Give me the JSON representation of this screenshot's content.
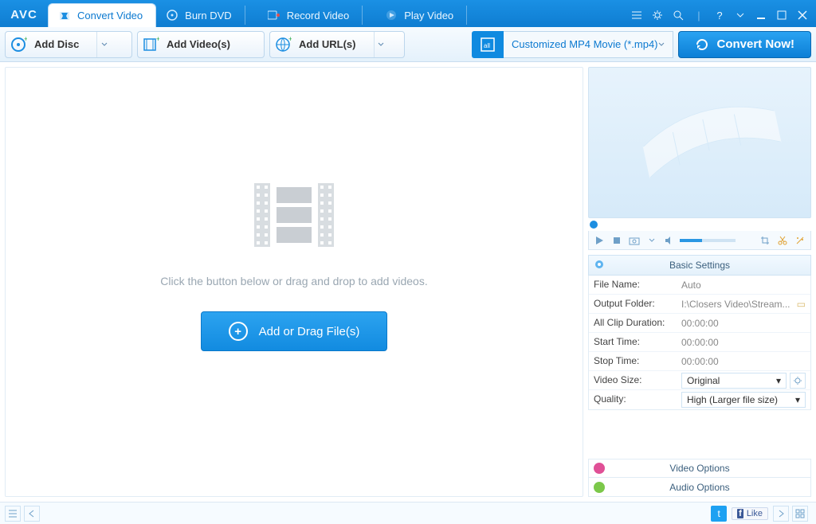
{
  "app": {
    "logo": "AVC"
  },
  "tabs": [
    {
      "label": "Convert Video",
      "active": true
    },
    {
      "label": "Burn DVD",
      "active": false
    },
    {
      "label": "Record Video",
      "active": false
    },
    {
      "label": "Play Video",
      "active": false
    }
  ],
  "toolbar": {
    "add_disc": "Add Disc",
    "add_videos": "Add Video(s)",
    "add_urls": "Add URL(s)",
    "format_selected": "Customized MP4 Movie (*.mp4)",
    "convert": "Convert Now!"
  },
  "drop": {
    "hint": "Click the button below or drag and drop to add videos.",
    "button": "Add or Drag File(s)"
  },
  "basic_settings": {
    "title": "Basic Settings",
    "rows": {
      "file_name_k": "File Name:",
      "file_name_v": "Auto",
      "output_folder_k": "Output Folder:",
      "output_folder_v": "I:\\Closers Video\\Stream...",
      "all_clip_k": "All Clip Duration:",
      "all_clip_v": "00:00:00",
      "start_k": "Start Time:",
      "start_v": "00:00:00",
      "stop_k": "Stop Time:",
      "stop_v": "00:00:00",
      "video_size_k": "Video Size:",
      "video_size_v": "Original",
      "quality_k": "Quality:",
      "quality_v": "High (Larger file size)"
    }
  },
  "options": {
    "video": "Video Options",
    "audio": "Audio Options"
  },
  "footer": {
    "like": "Like"
  }
}
